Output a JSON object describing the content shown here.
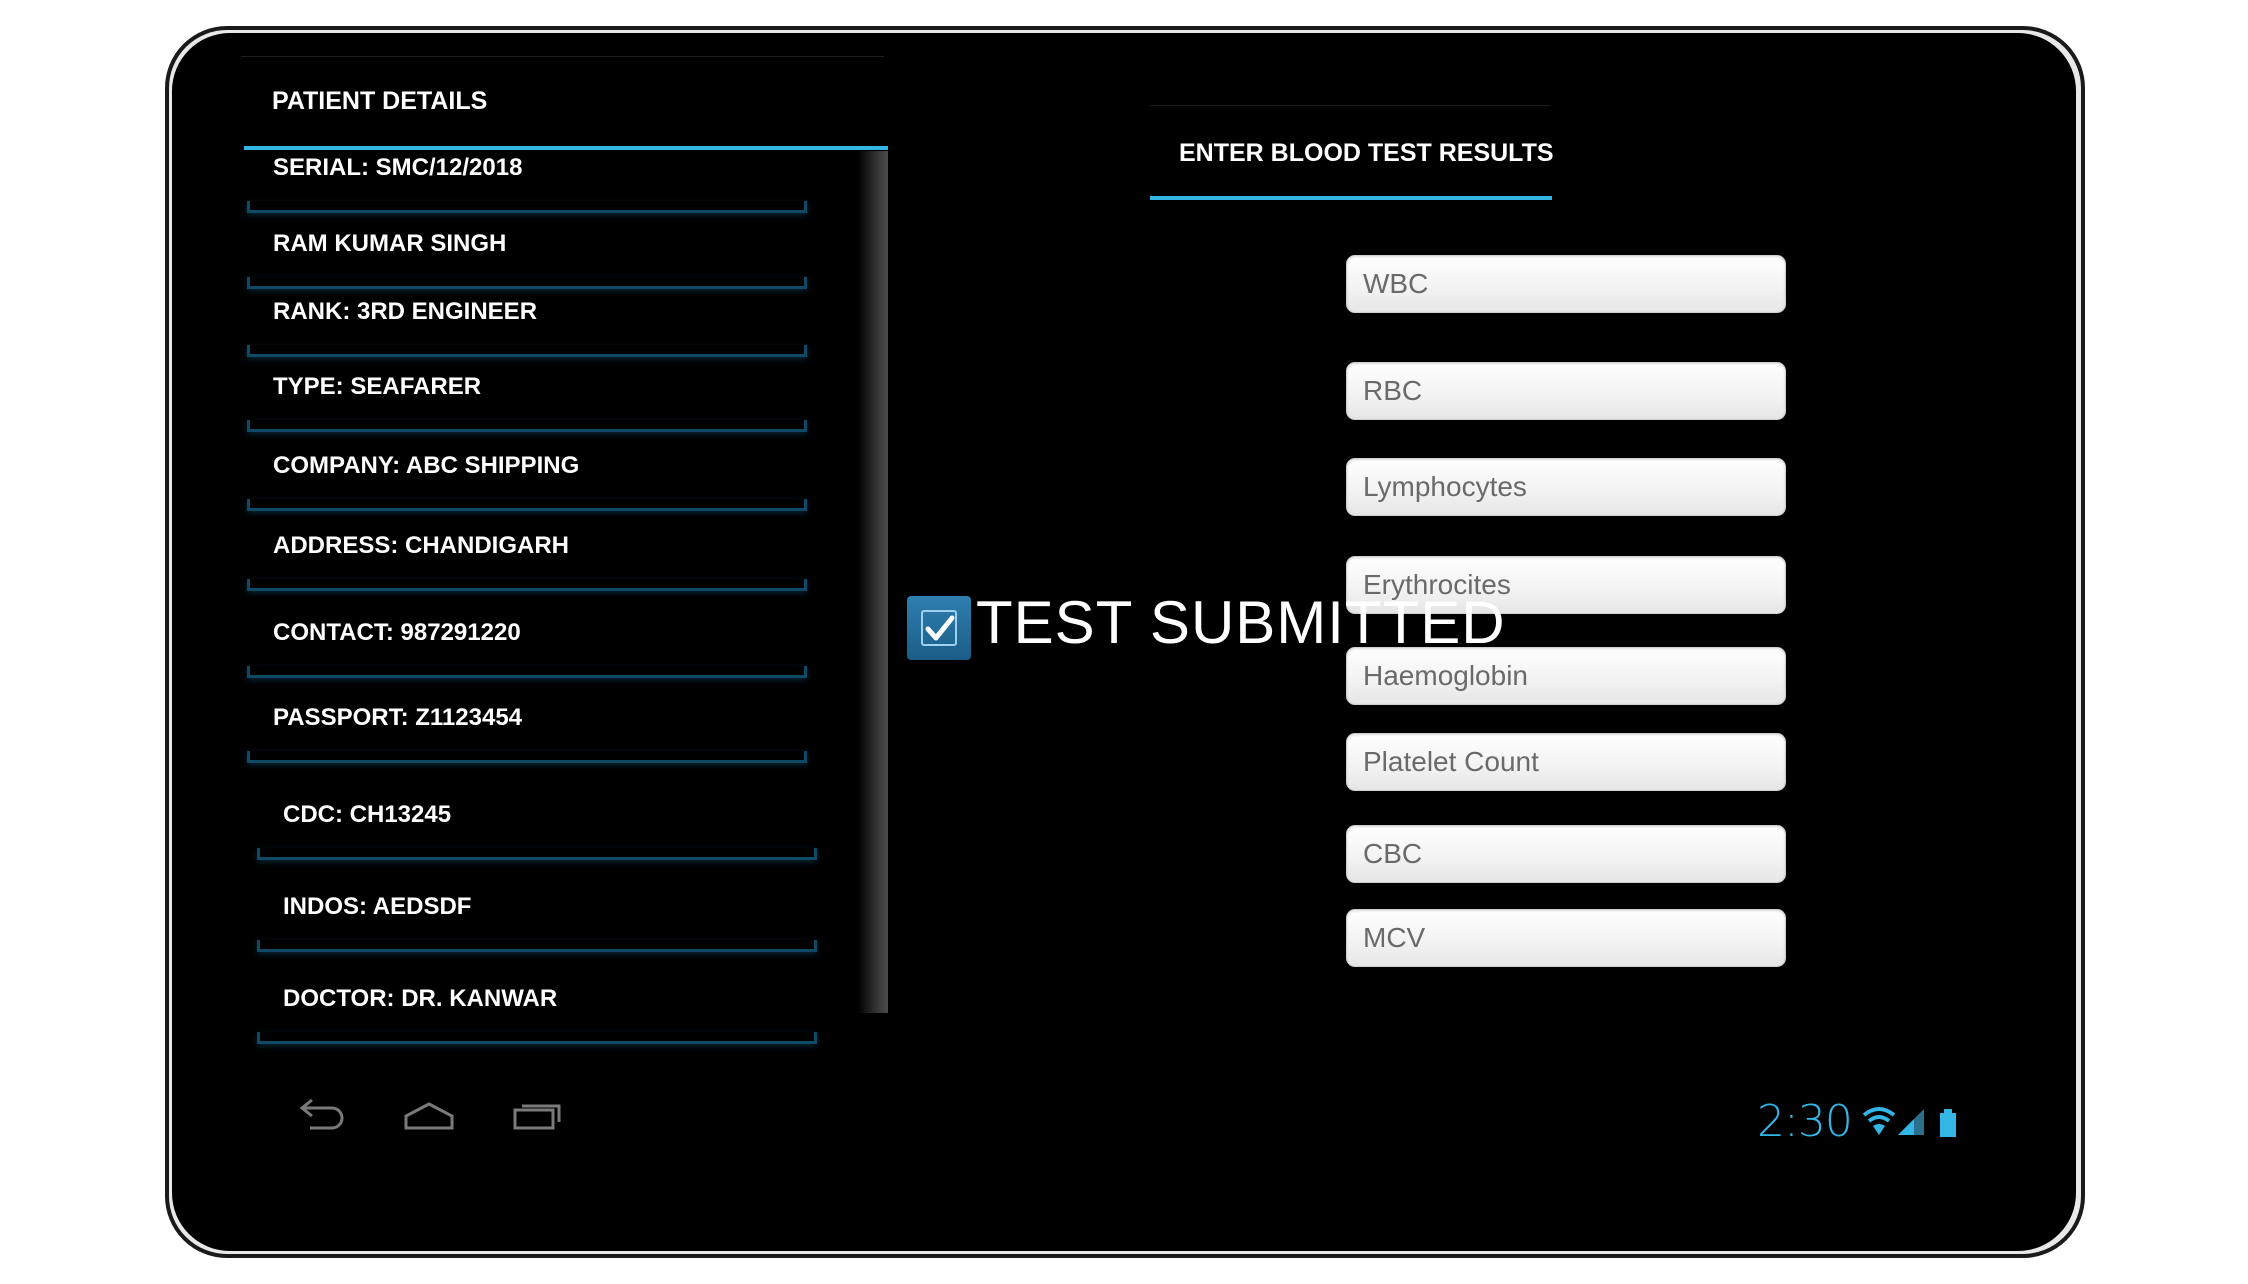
{
  "left_panel": {
    "title": "PATIENT DETAILS",
    "fields": [
      {
        "label": "SERIAL: SMC/12/2018"
      },
      {
        "label": "RAM KUMAR SINGH"
      },
      {
        "label": "RANK: 3RD ENGINEER"
      },
      {
        "label": "TYPE: SEAFARER"
      },
      {
        "label": "COMPANY: ABC SHIPPING"
      },
      {
        "label": "ADDRESS: CHANDIGARH"
      },
      {
        "label": "CONTACT: 987291220"
      },
      {
        "label": "PASSPORT: Z1123454"
      },
      {
        "label": "CDC: CH13245"
      },
      {
        "label": "INDOS: AEDSDF"
      },
      {
        "label": "DOCTOR: DR. KANWAR"
      }
    ]
  },
  "right_panel": {
    "title": "ENTER BLOOD TEST RESULTS",
    "inputs": [
      {
        "placeholder": "WBC",
        "value": ""
      },
      {
        "placeholder": "RBC",
        "value": ""
      },
      {
        "placeholder": "Lymphocytes",
        "value": ""
      },
      {
        "placeholder": "Erythrocites",
        "value": ""
      },
      {
        "placeholder": "Haemoglobin",
        "value": ""
      },
      {
        "placeholder": "Platelet Count",
        "value": ""
      },
      {
        "placeholder": "CBC",
        "value": ""
      },
      {
        "placeholder": "MCV",
        "value": ""
      }
    ]
  },
  "toast": {
    "text": "TEST SUBMITTED",
    "icon": "checkbox-checked-icon"
  },
  "nav_bar": {
    "back_icon": "back-icon",
    "home_icon": "home-icon",
    "recents_icon": "recent-apps-icon"
  },
  "status_bar": {
    "time": "2:30",
    "wifi_icon": "wifi-icon",
    "signal_icon": "signal-icon",
    "battery_icon": "battery-icon",
    "accent_color": "#33b5e5"
  }
}
